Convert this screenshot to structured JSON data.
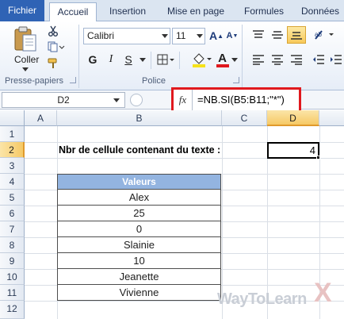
{
  "tabs": {
    "file": "Fichier",
    "home": "Accueil",
    "insert": "Insertion",
    "layout": "Mise en page",
    "formulas": "Formules",
    "data": "Données"
  },
  "ribbon": {
    "paste_label": "Coller",
    "clipboard_group": "Presse-papiers",
    "font_group": "Police",
    "font_name": "Calibri",
    "font_size": "11",
    "bold": "G",
    "italic": "I",
    "underline": "S",
    "grow": "A",
    "shrink": "A",
    "font_color_letter": "A",
    "font_color": "#e0191e",
    "fill_color": "#f6e21a"
  },
  "formula_bar": {
    "name_box": "D2",
    "fx": "fx",
    "formula": "=NB.SI(B5:B11;\"*\")"
  },
  "columns": [
    "A",
    "B",
    "C",
    "D"
  ],
  "rows": [
    "1",
    "2",
    "3",
    "4",
    "5",
    "6",
    "7",
    "8",
    "9",
    "10",
    "11",
    "12"
  ],
  "sheet": {
    "label_b2": "Nbr de cellule contenant du texte :",
    "result_d2": "4",
    "table_header": "Valeurs",
    "values": [
      "Alex",
      "25",
      "0",
      "Slainie",
      "10",
      "Jeanette",
      "Vivienne"
    ]
  },
  "watermark": {
    "text": "WayToLearn",
    "x": "X"
  }
}
